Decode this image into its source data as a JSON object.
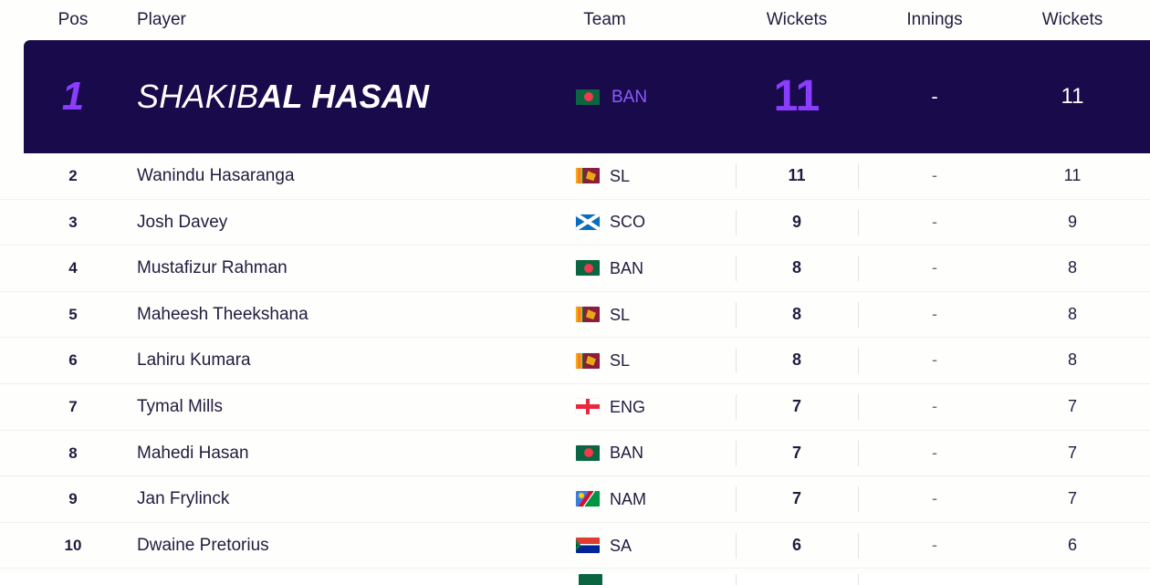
{
  "table": {
    "columns": [
      {
        "key": "pos",
        "label": "Pos"
      },
      {
        "key": "player",
        "label": "Player"
      },
      {
        "key": "team",
        "label": "Team"
      },
      {
        "key": "wickets",
        "label": "Wickets"
      },
      {
        "key": "innings",
        "label": "Innings"
      },
      {
        "key": "wickets2",
        "label": "Wickets"
      }
    ],
    "highlight": {
      "pos": "1",
      "player_first": "SHAKIB",
      "player_last": "AL HASAN",
      "team_code": "BAN",
      "team_flag": "flag-bangladesh-icon",
      "wickets": "11",
      "innings": "-",
      "wickets2": "11"
    },
    "rows": [
      {
        "pos": "2",
        "player": "Wanindu Hasaranga",
        "team_code": "SL",
        "team_flag": "flag-srilanka-icon",
        "wickets": "11",
        "innings": "-",
        "wickets2": "11"
      },
      {
        "pos": "3",
        "player": "Josh Davey",
        "team_code": "SCO",
        "team_flag": "flag-scotland-icon",
        "wickets": "9",
        "innings": "-",
        "wickets2": "9"
      },
      {
        "pos": "4",
        "player": "Mustafizur Rahman",
        "team_code": "BAN",
        "team_flag": "flag-bangladesh-icon",
        "wickets": "8",
        "innings": "-",
        "wickets2": "8"
      },
      {
        "pos": "5",
        "player": "Maheesh Theekshana",
        "team_code": "SL",
        "team_flag": "flag-srilanka-icon",
        "wickets": "8",
        "innings": "-",
        "wickets2": "8"
      },
      {
        "pos": "6",
        "player": "Lahiru Kumara",
        "team_code": "SL",
        "team_flag": "flag-srilanka-icon",
        "wickets": "8",
        "innings": "-",
        "wickets2": "8"
      },
      {
        "pos": "7",
        "player": "Tymal Mills",
        "team_code": "ENG",
        "team_flag": "flag-england-icon",
        "wickets": "7",
        "innings": "-",
        "wickets2": "7"
      },
      {
        "pos": "8",
        "player": "Mahedi Hasan",
        "team_code": "BAN",
        "team_flag": "flag-bangladesh-icon",
        "wickets": "7",
        "innings": "-",
        "wickets2": "7"
      },
      {
        "pos": "9",
        "player": "Jan Frylinck",
        "team_code": "NAM",
        "team_flag": "flag-namibia-icon",
        "wickets": "7",
        "innings": "-",
        "wickets2": "7"
      },
      {
        "pos": "10",
        "player": "Dwaine Pretorius",
        "team_code": "SA",
        "team_flag": "flag-southafrica-icon",
        "wickets": "6",
        "innings": "-",
        "wickets2": "6"
      }
    ]
  },
  "colors": {
    "highlight_background": "#180a4b",
    "accent_purple": "#8b3dff",
    "text_dark": "#231b3e",
    "page_background": "#fefefd",
    "row_divider": "#f1f1f2"
  }
}
